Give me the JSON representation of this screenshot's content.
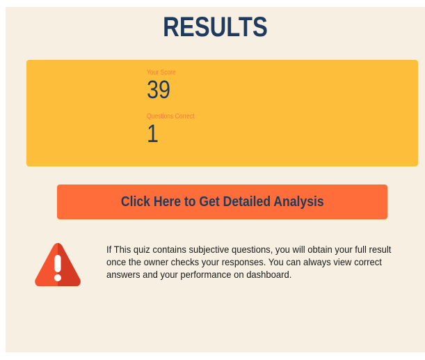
{
  "header": {
    "title": "RESULTS"
  },
  "score_card": {
    "score_label": "Your Score",
    "score_value": "39",
    "correct_label": "Questions Correct",
    "correct_value": "1",
    "background_color": "#fdbe3c"
  },
  "actions": {
    "analysis_button_label": "Click Here to Get Detailed Analysis",
    "button_color": "#fe6d3a"
  },
  "notice": {
    "icon": "warning-triangle-icon",
    "text": "If This quiz contains subjective questions, you will obtain your full result once the owner checks your responses. You can always view correct answers and your performance on dashboard."
  },
  "colors": {
    "page_background": "#f6efe2",
    "title_text": "#1e3a5c",
    "label_text": "#f27a3f"
  }
}
